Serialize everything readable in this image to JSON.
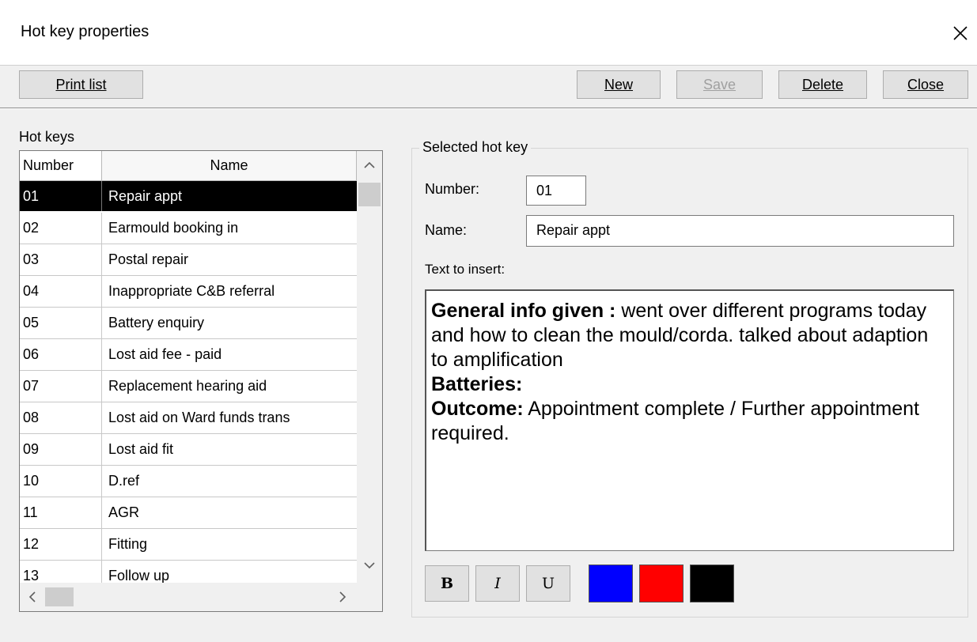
{
  "window": {
    "title": "Hot key properties"
  },
  "toolbar": {
    "print_list": "Print list",
    "new": "New",
    "save": "Save",
    "delete": "Delete",
    "close": "Close"
  },
  "list": {
    "label": "Hot keys",
    "columns": [
      "Number",
      "Name"
    ],
    "rows": [
      {
        "number": "01",
        "name": "Repair appt",
        "selected": true
      },
      {
        "number": "02",
        "name": "Earmould booking in"
      },
      {
        "number": "03",
        "name": "Postal repair"
      },
      {
        "number": "04",
        "name": "Inappropriate C&B referral"
      },
      {
        "number": "05",
        "name": "Battery enquiry"
      },
      {
        "number": "06",
        "name": "Lost aid fee - paid"
      },
      {
        "number": "07",
        "name": "Replacement hearing aid"
      },
      {
        "number": "08",
        "name": "Lost aid on Ward funds trans"
      },
      {
        "number": "09",
        "name": "Lost aid fit"
      },
      {
        "number": "10",
        "name": "D.ref"
      },
      {
        "number": "11",
        "name": "AGR"
      },
      {
        "number": "12",
        "name": "Fitting"
      },
      {
        "number": "13",
        "name": "Follow up"
      }
    ]
  },
  "selected": {
    "legend": "Selected hot key",
    "number_label": "Number:",
    "number_value": "01",
    "name_label": "Name:",
    "name_value": "Repair appt",
    "text_label": "Text to insert:",
    "text": {
      "general_label": "General info given :",
      "general_text": " went over different programs today and how to clean the mould/corda. talked about adaption to amplification",
      "batteries_label": "Batteries:",
      "outcome_label": "Outcome:",
      "outcome_text": " Appointment complete / Further appointment required."
    }
  },
  "format": {
    "bold": "B",
    "italic": "I",
    "underline": "U",
    "colors": [
      "#0000ff",
      "#ff0000",
      "#000000"
    ]
  }
}
